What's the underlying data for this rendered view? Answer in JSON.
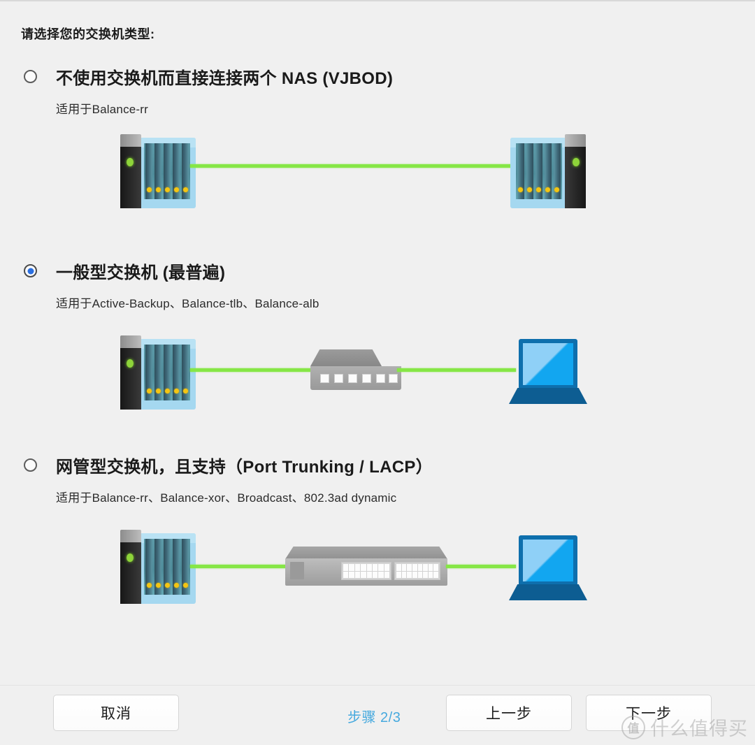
{
  "panel": {
    "heading": "请选择您的交换机类型:"
  },
  "options": [
    {
      "id": "direct-nas",
      "title": "不使用交换机而直接连接两个 NAS (VJBOD)",
      "subtitle": "适用于Balance-rr",
      "selected": false,
      "diagram": "nas-wire-nas"
    },
    {
      "id": "general-switch",
      "title": "一般型交换机 (最普遍)",
      "subtitle": "适用于Active-Backup、Balance-tlb、Balance-alb",
      "selected": true,
      "diagram": "nas-wire-switch-wire-laptop"
    },
    {
      "id": "managed-switch",
      "title": "网管型交换机，且支持（Port Trunking / LACP）",
      "subtitle": "适用于Balance-rr、Balance-xor、Broadcast、802.3ad dynamic",
      "selected": false,
      "diagram": "nas-wire-managedswitch-wire-laptop"
    }
  ],
  "footer": {
    "cancel_label": "取消",
    "step_label": "步骤 2/3",
    "previous_label": "上一步",
    "next_label": "下一步"
  },
  "watermark": {
    "mark": "值",
    "text": "什么值得买"
  },
  "colors": {
    "page_background": "#f0f0f0",
    "wire_green": "#86e646",
    "radio_accent": "#2b6fe0",
    "step_blue": "#46a9de",
    "nas_glass": "#a5d8f0",
    "laptop_blue": "#0e6fad",
    "switch_gray": "#a8a8a8"
  }
}
